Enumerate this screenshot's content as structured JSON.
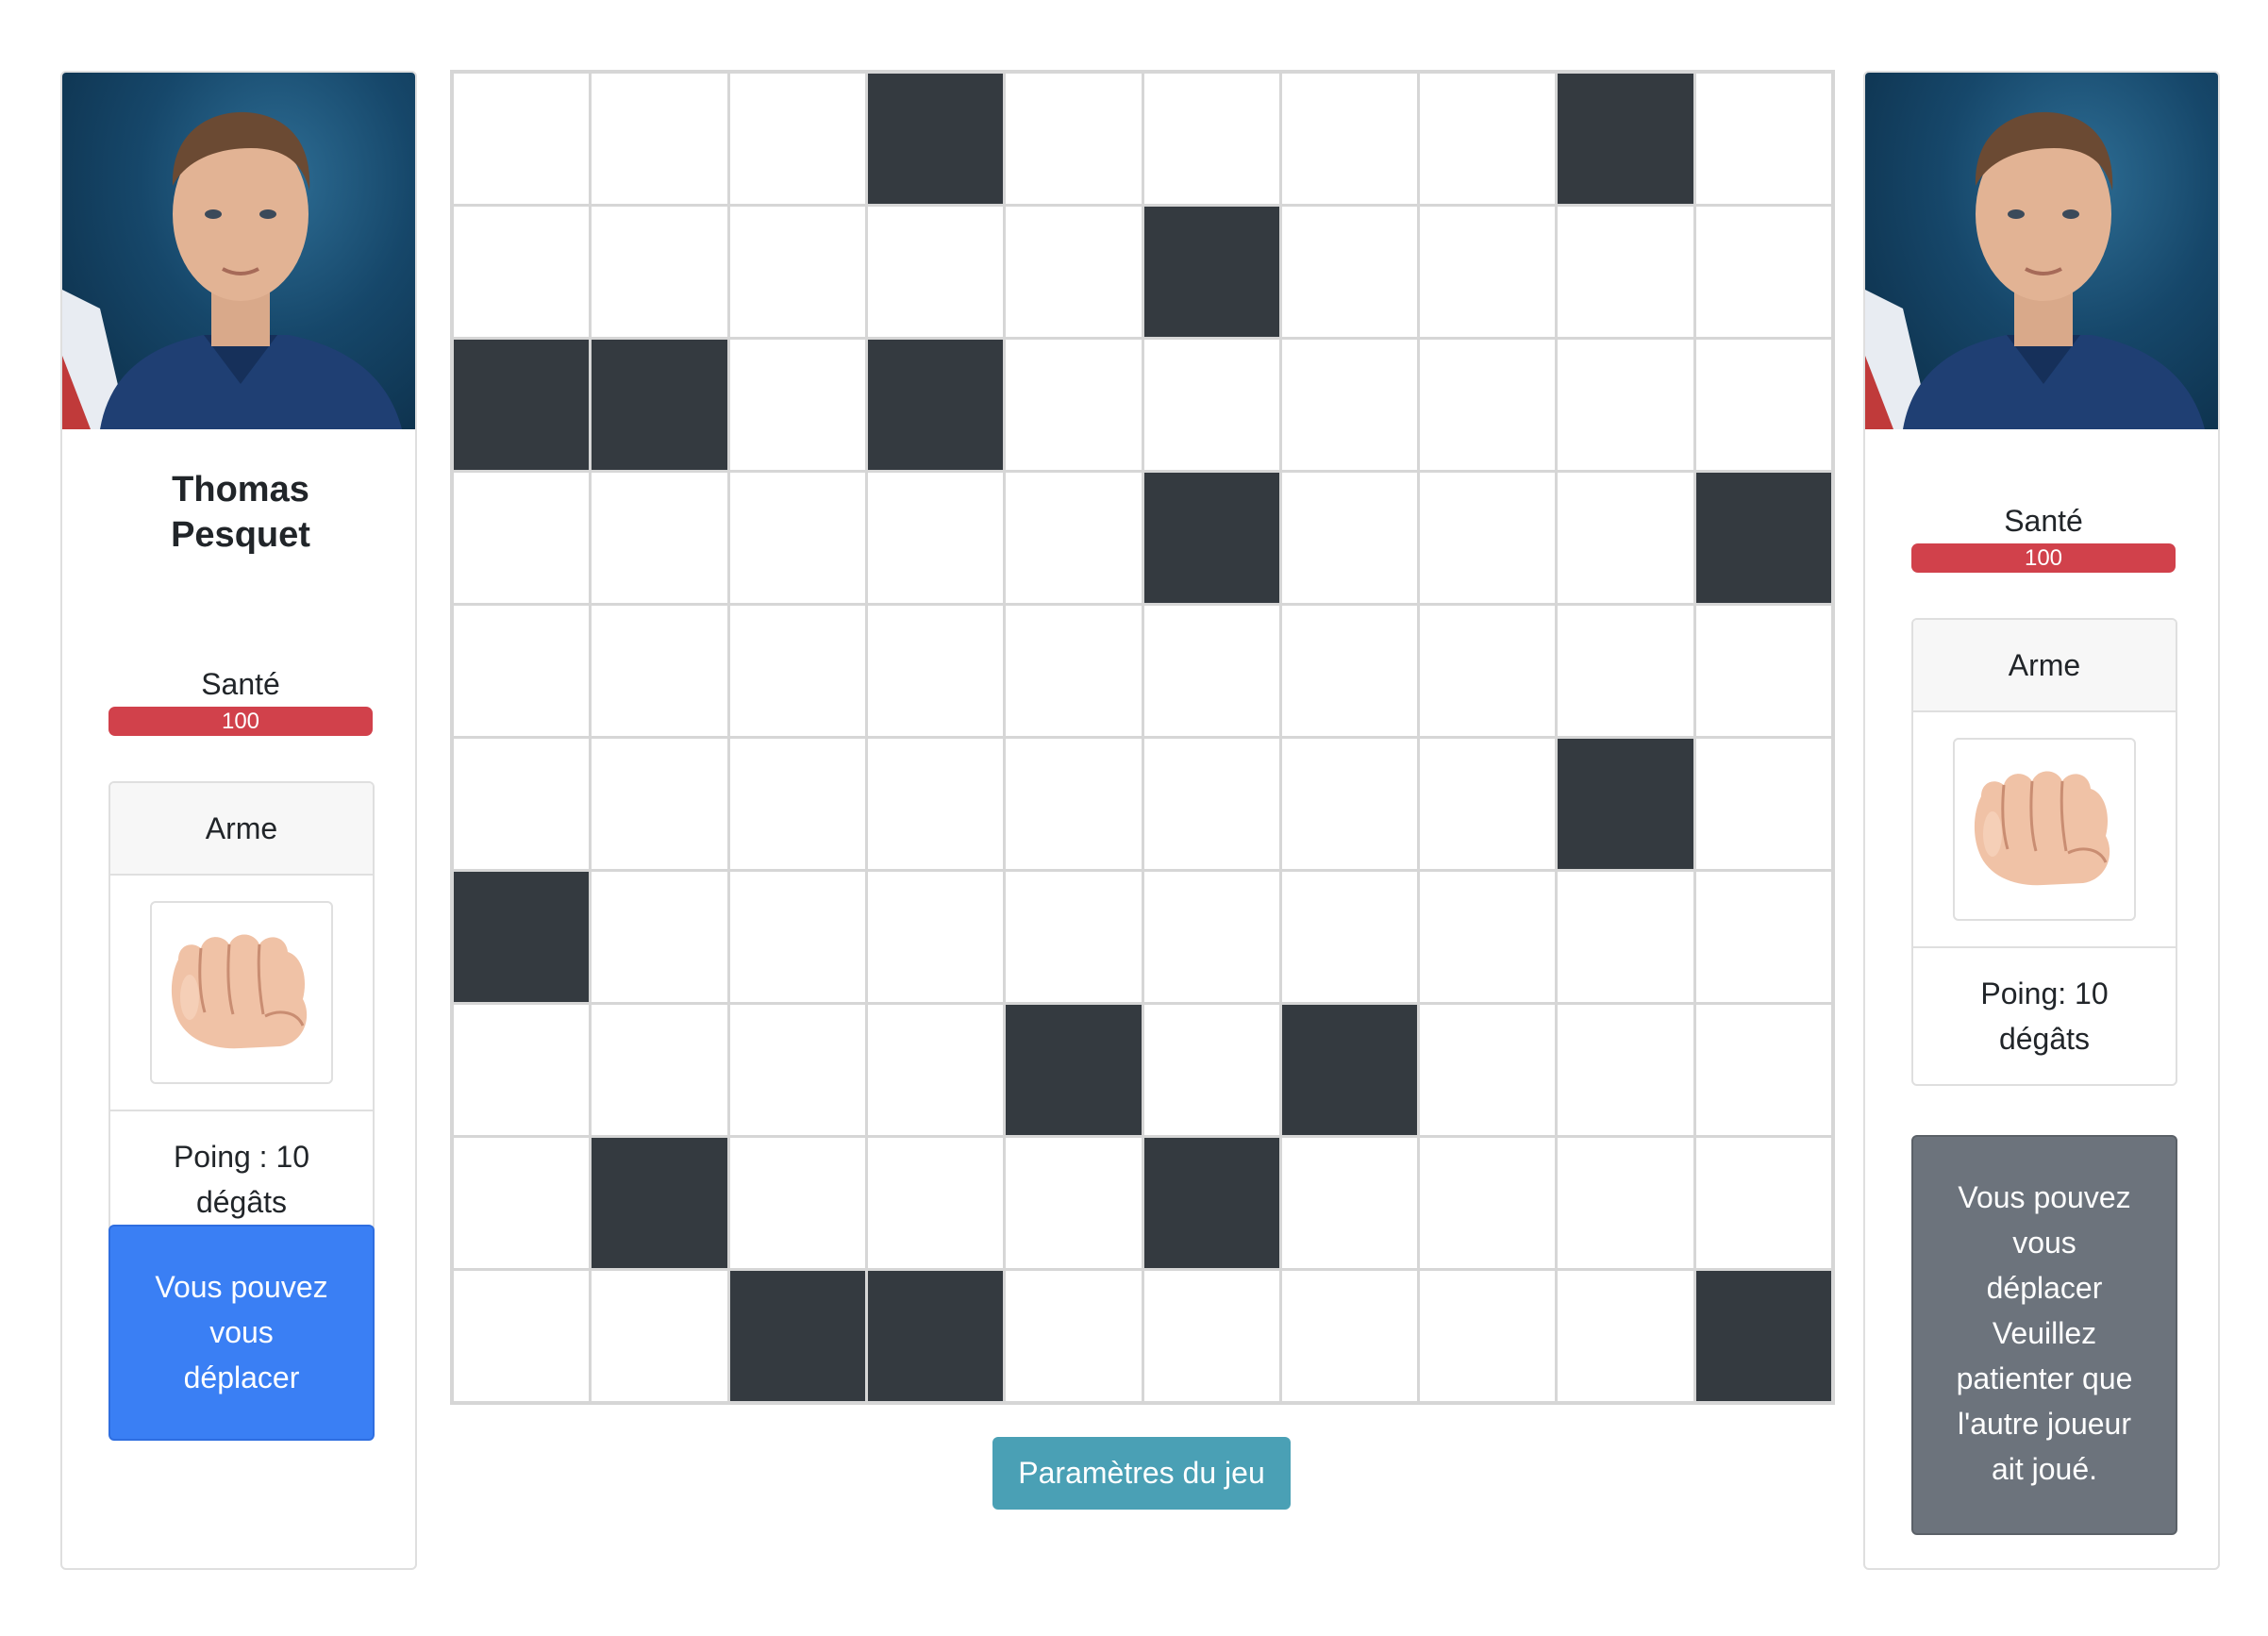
{
  "players": [
    {
      "name_line1": "Thomas",
      "name_line2": "Pesquet",
      "health_label": "Santé",
      "health_value": "100",
      "health_fraction": 1.0,
      "health_color": "#d1414b",
      "weapon": {
        "header": "Arme",
        "icon": "fist-icon",
        "desc_line1": "Poing : 10",
        "desc_line2": "dégâts"
      },
      "status_lines": [
        "Vous pouvez",
        "vous",
        "déplacer"
      ],
      "status_color": "#3a7ff4"
    },
    {
      "name_line1": "",
      "name_line2": "",
      "health_label": "Santé",
      "health_value": "100",
      "health_fraction": 1.0,
      "health_color": "#d1414b",
      "weapon": {
        "header": "Arme",
        "icon": "fist-icon",
        "desc_line1": "Poing: 10",
        "desc_line2": "dégâts"
      },
      "status_lines": [
        "Vous pouvez",
        "vous",
        "déplacer",
        "Veuillez",
        "patienter que",
        "l'autre joueur",
        "ait joué."
      ],
      "status_color": "#6c737c"
    }
  ],
  "board": {
    "rows": 10,
    "cols": 10,
    "wall_color": "#343a40",
    "walls": [
      [
        0,
        3
      ],
      [
        0,
        8
      ],
      [
        1,
        5
      ],
      [
        2,
        0
      ],
      [
        2,
        1
      ],
      [
        2,
        3
      ],
      [
        3,
        5
      ],
      [
        3,
        9
      ],
      [
        5,
        8
      ],
      [
        6,
        0
      ],
      [
        7,
        4
      ],
      [
        7,
        6
      ],
      [
        8,
        1
      ],
      [
        8,
        5
      ],
      [
        9,
        2
      ],
      [
        9,
        3
      ],
      [
        9,
        9
      ]
    ]
  },
  "settings_button_label": "Paramètres du jeu",
  "settings_button_color": "#4aa0b5"
}
